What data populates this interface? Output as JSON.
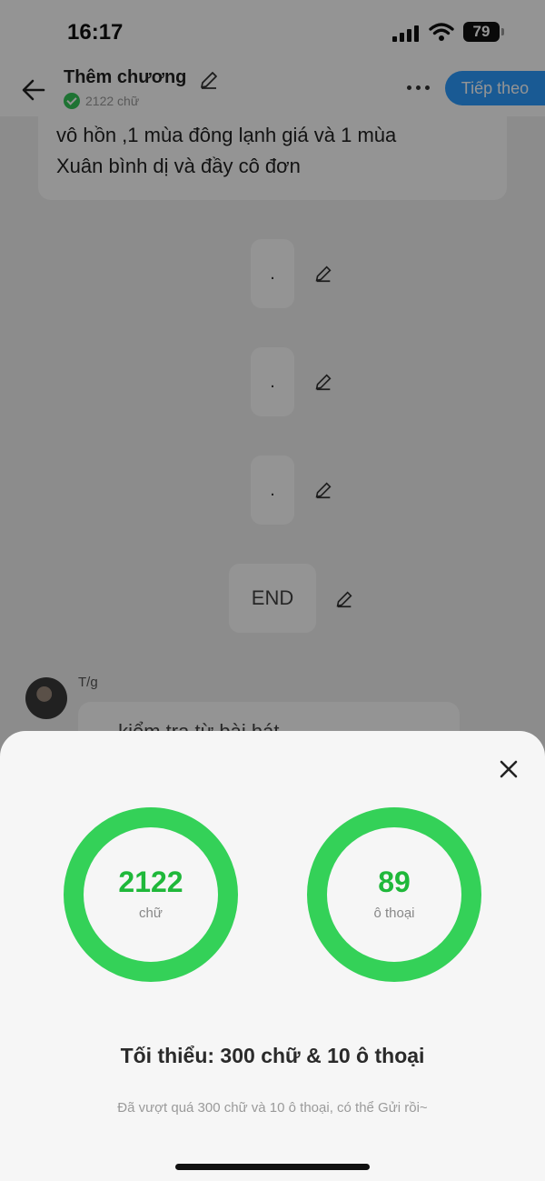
{
  "status_bar": {
    "time": "16:17",
    "battery": "79"
  },
  "nav": {
    "title": "Thêm chương",
    "word_count": "2122 chữ",
    "next_label": "Tiếp theo"
  },
  "content": {
    "text_lines": [
      "vô hồn ,1 mùa đông lạnh giá và 1 mùa",
      "Xuân bình dị và đầy cô đơn"
    ],
    "dot_items": [
      ".",
      ".",
      "."
    ],
    "end_label": "END",
    "author": {
      "name": "T/g",
      "preview": "… kiểm tra từ bài hát…"
    }
  },
  "sheet": {
    "words": {
      "value": "2122",
      "label": "chữ"
    },
    "dialogues": {
      "value": "89",
      "label": "ô thoại"
    },
    "minimum_text": "Tối thiểu: 300 chữ & 10 ô thoại",
    "hint_text": "Đã vượt quá 300 chữ và 10 ô thoại, có thể Gửi rồi~"
  },
  "colors": {
    "accent": "#2b9bff",
    "ring": "#34d158",
    "ring_value": "#1fb83a"
  }
}
